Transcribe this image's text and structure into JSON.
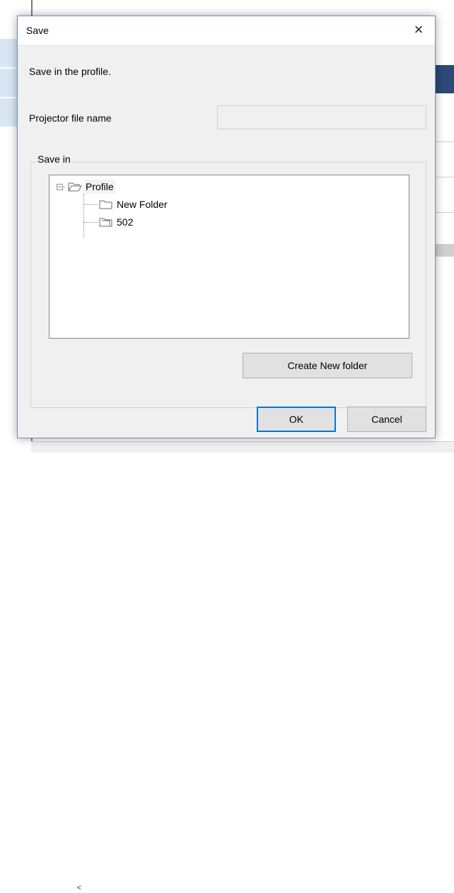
{
  "dialog": {
    "title": "Save",
    "close_label": "×",
    "info_text": "Save in the profile.",
    "file_name_label": "Projector file name",
    "file_name_value": "",
    "group_label": "Save in",
    "tree": {
      "root": {
        "label": "Profile",
        "expanded": true,
        "selected": true
      },
      "children": [
        {
          "label": "New Folder"
        },
        {
          "label": "502"
        }
      ]
    },
    "create_folder_label": "Create New folder",
    "ok_label": "OK",
    "cancel_label": "Cancel"
  },
  "background": {
    "scroll_left_label": "<"
  },
  "colors": {
    "dialog_bg": "#f0f0f0",
    "accent_border": "#0078d7",
    "tree_border": "#828790"
  }
}
